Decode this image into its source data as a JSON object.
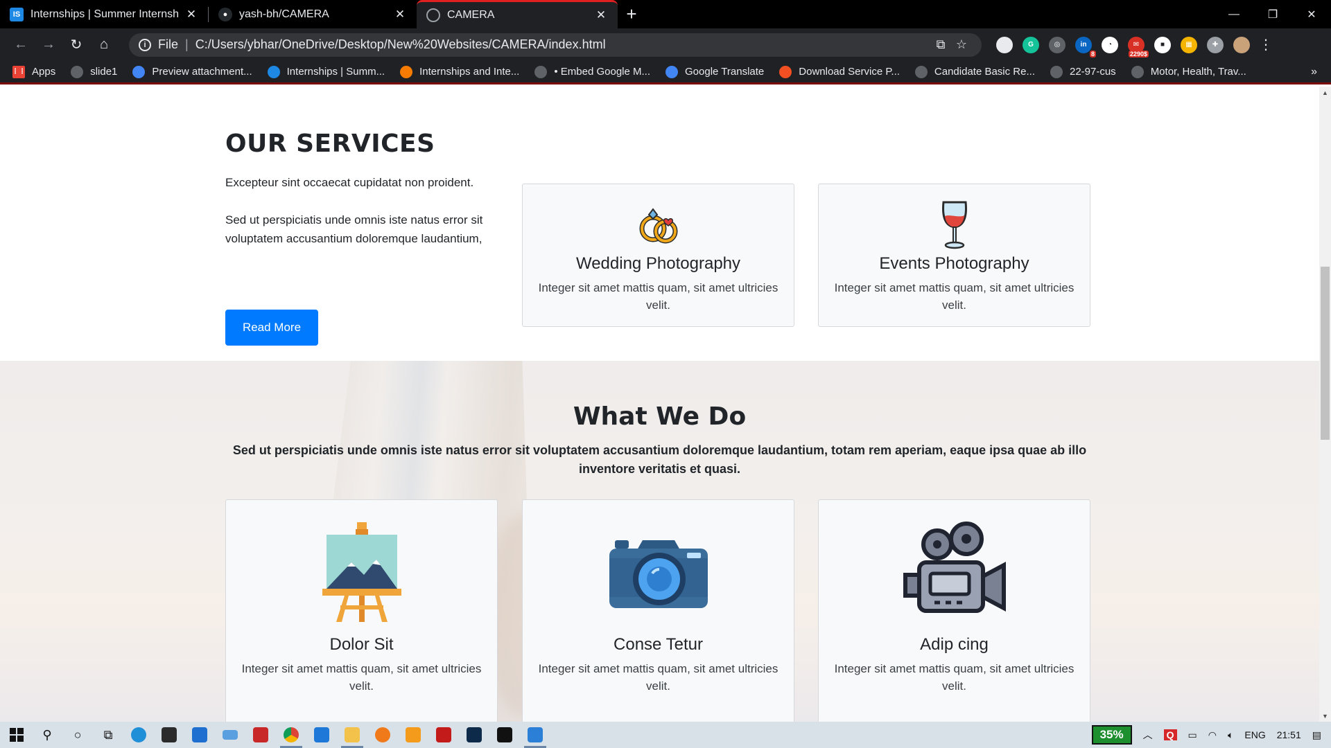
{
  "browser": {
    "tabs": [
      {
        "title": "Internships | Summer Internship",
        "favicon": "IS",
        "favicon_color": "#1e88e5",
        "active": false
      },
      {
        "title": "yash-bh/CAMERA",
        "favicon": "github-icon",
        "favicon_color": "#24292e",
        "active": false
      },
      {
        "title": "CAMERA",
        "favicon": "globe-icon",
        "favicon_color": "#9aa0a6",
        "active": true
      }
    ],
    "new_tab_label": "+",
    "address": {
      "scheme_label": "File",
      "url": "C:/Users/ybhar/OneDrive/Desktop/New%20Websites/CAMERA/index.html"
    },
    "extensions": [
      {
        "name": "circle-ext-icon",
        "color": "#e8eaed",
        "label": ""
      },
      {
        "name": "grammarly-icon",
        "color": "#15c39a",
        "label": "G"
      },
      {
        "name": "mask-ext-icon",
        "color": "#5f6368",
        "label": "◎"
      },
      {
        "name": "linkedin-icon",
        "color": "#0a66c2",
        "label": "in",
        "badge": "8"
      },
      {
        "name": "stopwatch-ext-icon",
        "color": "#ffffff",
        "label": "◔"
      },
      {
        "name": "mail-ext-icon",
        "color": "#d93025",
        "label": "✉",
        "badge": "2290$"
      },
      {
        "name": "camera-ext-icon",
        "color": "#ffffff",
        "label": "■"
      },
      {
        "name": "color-ext-icon",
        "color": "#f4b400",
        "label": "▦"
      },
      {
        "name": "puzzle-icon",
        "color": "#9aa0a6",
        "label": "✚"
      },
      {
        "name": "profile-avatar-icon",
        "color": "#c9a27a",
        "label": ""
      }
    ],
    "bookmarks": [
      {
        "label": "Apps",
        "icon": "apps-grid-icon",
        "color": "#ea4335"
      },
      {
        "label": "slide1",
        "icon": "globe-icon",
        "color": "#5f6368"
      },
      {
        "label": "Preview attachment...",
        "icon": "google-icon",
        "color": "#4285f4"
      },
      {
        "label": "Internships | Summ...",
        "icon": "internshala-icon",
        "color": "#1e88e5"
      },
      {
        "label": "Internships and Inte...",
        "icon": "flame-icon",
        "color": "#f57c00"
      },
      {
        "label": "• Embed Google M...",
        "icon": "globe-icon",
        "color": "#5f6368"
      },
      {
        "label": "Google Translate",
        "icon": "translate-icon",
        "color": "#4285f4"
      },
      {
        "label": "Download Service P...",
        "icon": "microsoft-icon",
        "color": "#f25022"
      },
      {
        "label": "Candidate Basic Re...",
        "icon": "globe-icon",
        "color": "#5f6368"
      },
      {
        "label": "22-97-cus",
        "icon": "globe-icon",
        "color": "#5f6368"
      },
      {
        "label": "Motor, Health, Trav...",
        "icon": "globe-icon",
        "color": "#5f6368"
      }
    ]
  },
  "services": {
    "heading": "OUR SERVICES",
    "intro": "Excepteur sint occaecat cupidatat non proident.",
    "body": "Sed ut perspiciatis unde omnis iste natus error sit voluptatem accusantium doloremque laudantium,",
    "button": "Read More",
    "cards": [
      {
        "title": "Wedding Photography",
        "text": "Integer sit amet mattis quam, sit amet ultricies velit.",
        "icon": "wedding-rings-icon"
      },
      {
        "title": "Events Photography",
        "text": "Integer sit amet mattis quam, sit amet ultricies velit.",
        "icon": "wine-glass-icon"
      }
    ]
  },
  "what_we_do": {
    "heading": "What We Do",
    "lead": "Sed ut perspiciatis unde omnis iste natus error sit voluptatem accusantium doloremque laudantium, totam rem aperiam, eaque ipsa quae ab illo inventore veritatis et quasi.",
    "cards": [
      {
        "title": "Dolor Sit",
        "text": "Integer sit amet mattis quam, sit amet ultricies velit.",
        "icon": "easel-painting-icon"
      },
      {
        "title": "Conse Tetur",
        "text": "Integer sit amet mattis quam, sit amet ultricies velit.",
        "icon": "camera-icon"
      },
      {
        "title": "Adip cing",
        "text": "Integer sit amet mattis quam, sit amet ultricies velit.",
        "icon": "movie-camera-icon"
      }
    ]
  },
  "taskbar": {
    "battery": "35%",
    "language": "ENG",
    "time": "21:51"
  },
  "colors": {
    "primary_button": "#007bff",
    "card_bg": "#f8f9fa",
    "active_tab_accent": "#e02020"
  }
}
